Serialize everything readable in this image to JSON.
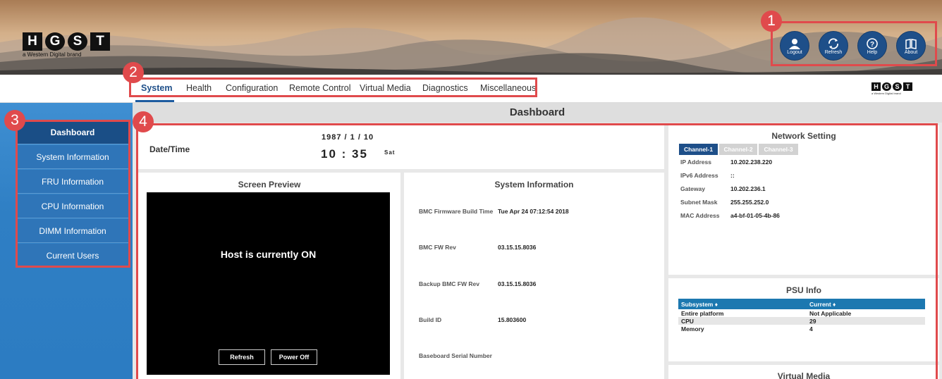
{
  "brand": {
    "tiles": [
      "H",
      "G",
      "S",
      "T"
    ],
    "subtitle": "a Western Digital brand"
  },
  "header_buttons": [
    {
      "icon": "user-icon",
      "label": "Logout"
    },
    {
      "icon": "refresh-icon",
      "label": "Refresh"
    },
    {
      "icon": "help-icon",
      "label": "Help"
    },
    {
      "icon": "book-icon",
      "label": "About"
    }
  ],
  "markers": [
    "1",
    "2",
    "3",
    "4"
  ],
  "nav_tabs": [
    "System",
    "Health",
    "Configuration",
    "Remote Control",
    "Virtual Media",
    "Diagnostics",
    "Miscellaneous"
  ],
  "sidebar_items": [
    "Dashboard",
    "System Information",
    "FRU Information",
    "CPU Information",
    "DIMM Information",
    "Current Users"
  ],
  "dashboard": {
    "title": "Dashboard",
    "datetime": {
      "label": "Date/Time",
      "date": "1987 / 1 / 10",
      "time": "10 : 35",
      "day": "Sat"
    },
    "screen_preview": {
      "title": "Screen Preview",
      "message": "Host is currently ON",
      "refresh_label": "Refresh",
      "power_off_label": "Power Off"
    },
    "system_information": {
      "title": "System Information",
      "rows": [
        {
          "key": "BMC Firmware Build Time",
          "value": "Tue Apr 24 07:12:54 2018"
        },
        {
          "key": "BMC FW Rev",
          "value": "03.15.15.8036"
        },
        {
          "key": "Backup BMC FW Rev",
          "value": "03.15.15.8036"
        },
        {
          "key": "Build ID",
          "value": "15.803600"
        },
        {
          "key": "Baseboard Serial Number",
          "value": ""
        }
      ]
    },
    "network_setting": {
      "title": "Network Setting",
      "channels": [
        "Channel-1",
        "Channel-2",
        "Channel-3"
      ],
      "active_channel": "Channel-1",
      "rows": [
        {
          "key": "IP Address",
          "value": "10.202.238.220"
        },
        {
          "key": "IPv6 Address",
          "value": "::"
        },
        {
          "key": "Gateway",
          "value": "10.202.236.1"
        },
        {
          "key": "Subnet Mask",
          "value": "255.255.252.0"
        },
        {
          "key": "MAC Address",
          "value": "a4-bf-01-05-4b-86"
        }
      ]
    },
    "psu_info": {
      "title": "PSU Info",
      "columns": [
        "Subsystem ♦",
        "Current ♦"
      ],
      "rows": [
        [
          "Entire platform",
          "Not Applicable"
        ],
        [
          "CPU",
          "29"
        ],
        [
          "Memory",
          "4"
        ]
      ]
    },
    "virtual_media": {
      "title": "Virtual Media"
    }
  },
  "colors": {
    "accent": "#1e4f89",
    "sidebar": "#2f7fc4",
    "annotation": "#e04a4c",
    "table_header": "#1c78b0"
  }
}
